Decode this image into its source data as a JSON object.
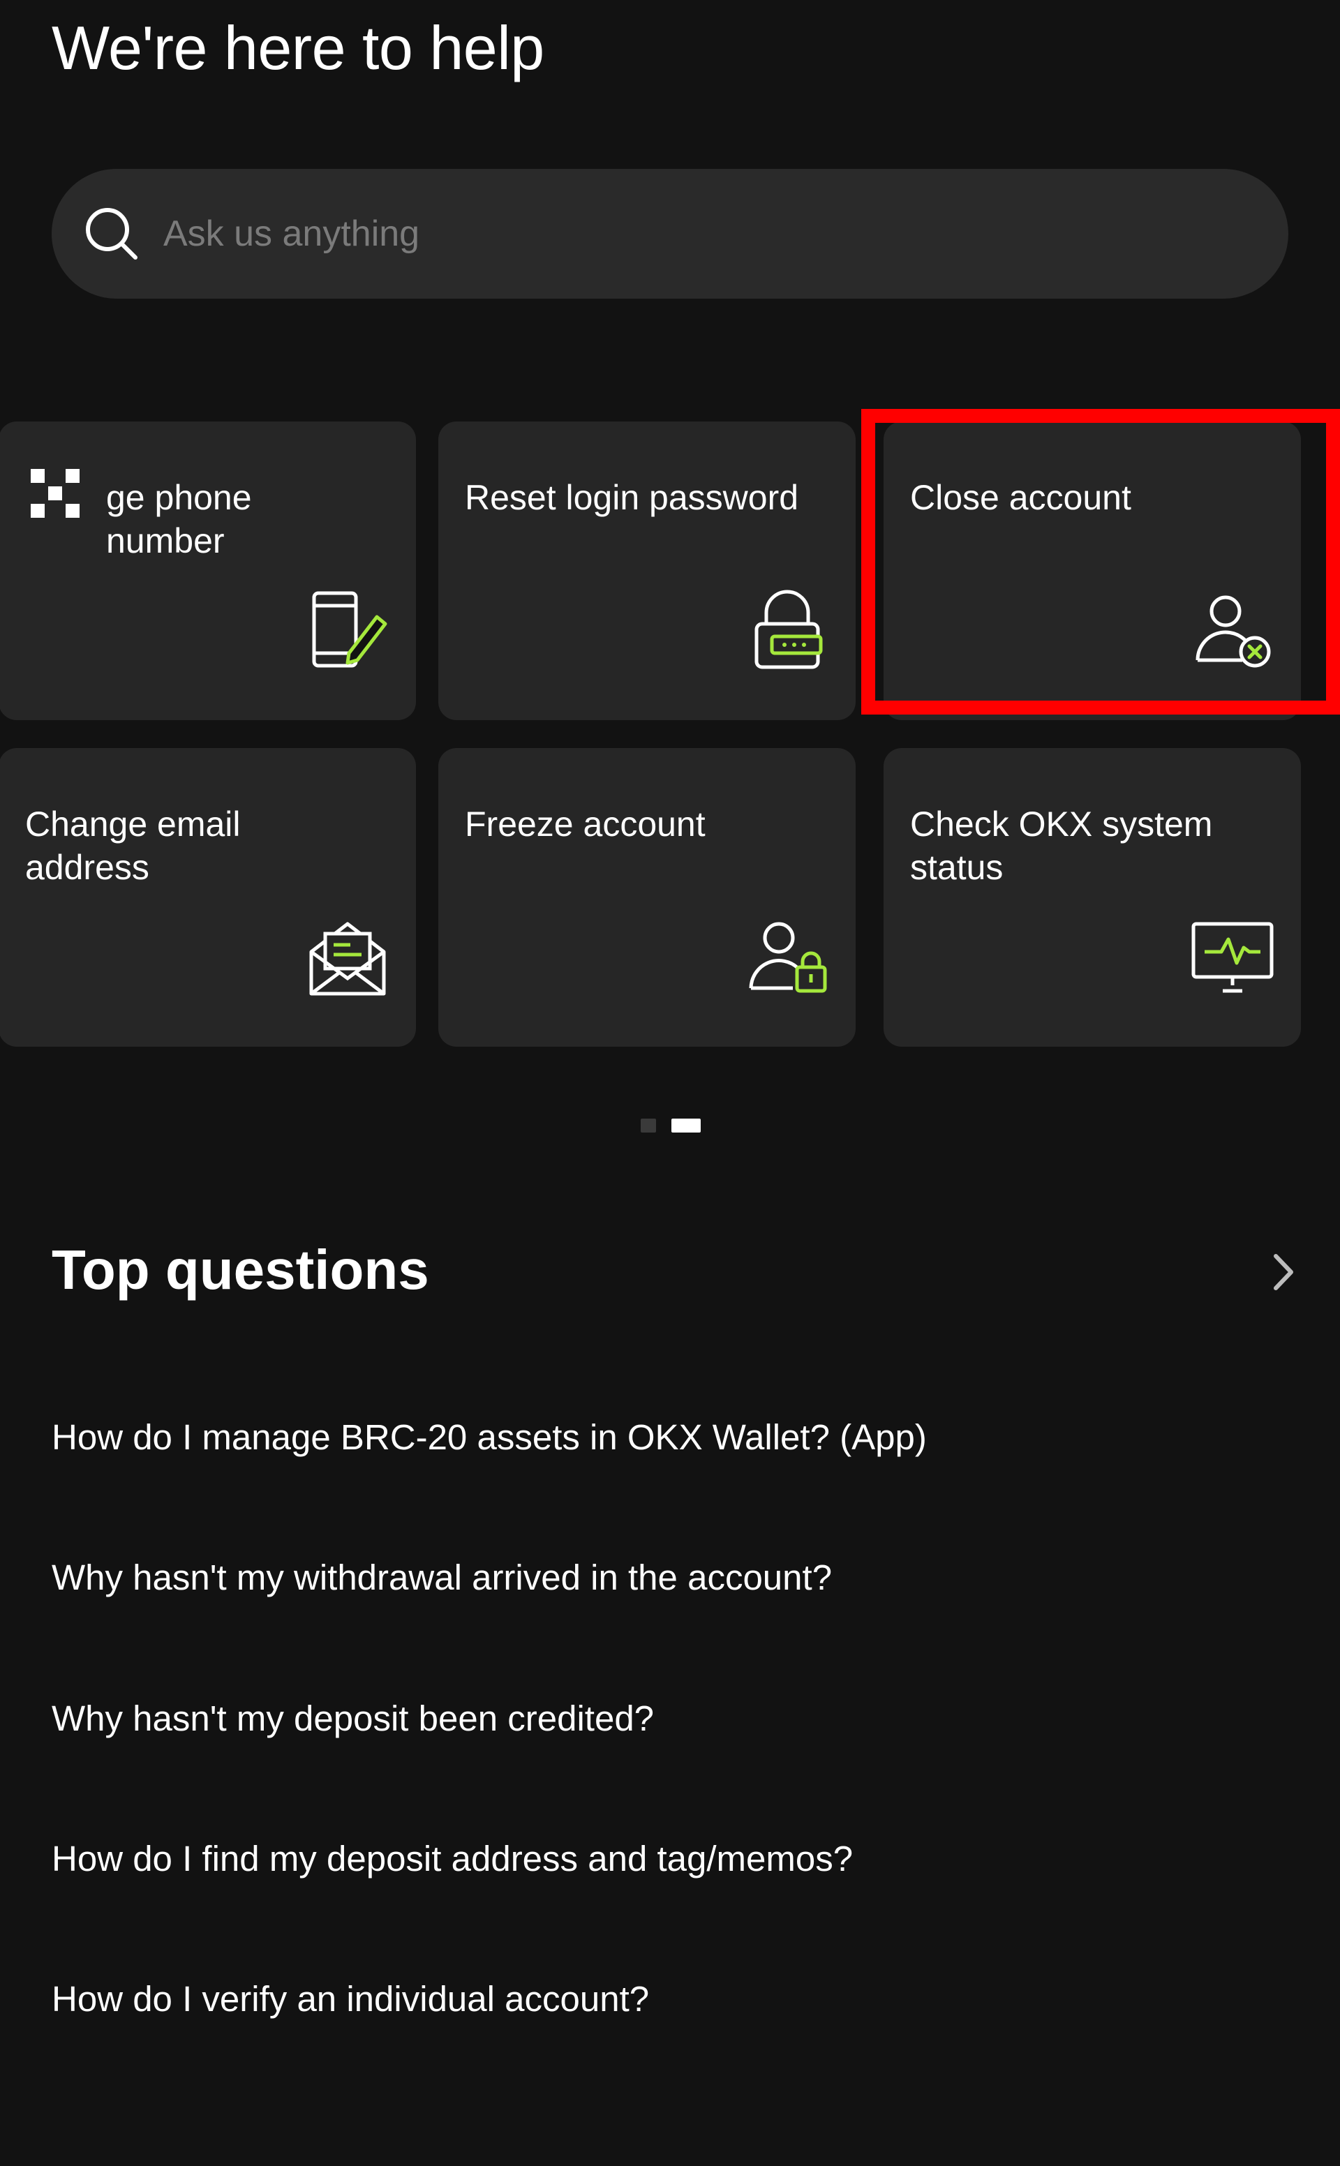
{
  "header": {
    "title": "We're here to help"
  },
  "search": {
    "placeholder": "Ask us anything",
    "icon": "search-icon"
  },
  "quick_actions": [
    {
      "label": "Change phone number",
      "visible_label": "ge phone\nnumber",
      "icon": "phone-edit-icon"
    },
    {
      "label": "Reset login password",
      "icon": "padlock-icon"
    },
    {
      "label": "Close account",
      "icon": "user-remove-icon",
      "highlighted": true
    },
    {
      "label": "Change email\naddress",
      "icon": "email-envelope-icon"
    },
    {
      "label": "Freeze account",
      "icon": "user-lock-icon"
    },
    {
      "label": "Check OKX system\nstatus",
      "icon": "monitor-pulse-icon"
    }
  ],
  "pagination": {
    "pages": 2,
    "active": 2
  },
  "top_questions": {
    "title": "Top questions",
    "items": [
      "How do I manage BRC-20 assets in OKX Wallet? (App)",
      "Why hasn't my withdrawal arrived in the account?",
      "Why hasn't my deposit been credited?",
      "How do I find my deposit address and tag/memos?",
      "How do I verify an individual account?"
    ]
  },
  "colors": {
    "background": "#121212",
    "card": "#262626",
    "accent": "#a5e83c",
    "highlight": "#ff0000"
  }
}
